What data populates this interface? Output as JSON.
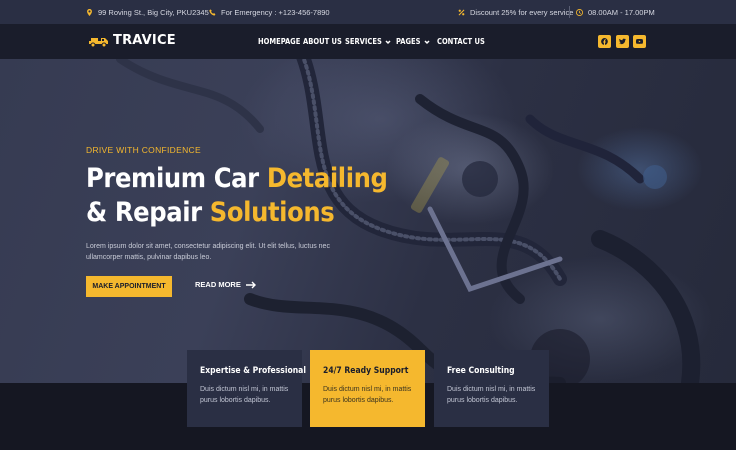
{
  "topbar": {
    "address": "99 Roving St., Big City, PKU2345",
    "emergency": "For Emergency : +123-456-7890",
    "discount": "Discount 25% for every service",
    "hours": "08.00AM - 17.00PM"
  },
  "brand": {
    "name": "TRAVICE"
  },
  "nav": {
    "items": [
      {
        "label": "HOMEPAGE"
      },
      {
        "label": "ABOUT US"
      },
      {
        "label": "SERVICES"
      },
      {
        "label": "PAGES"
      },
      {
        "label": "CONTACT US"
      }
    ]
  },
  "social": [
    "facebook-icon",
    "twitter-icon",
    "youtube-icon"
  ],
  "hero": {
    "eyebrow": "DRIVE WITH CONFIDENCE",
    "headline_line1_a": "Premium Car ",
    "headline_line1_b": "Detailing",
    "headline_line2_a": "& Repair ",
    "headline_line2_b": "Solutions",
    "lede": "Lorem ipsum dolor sit amet, consectetur adipiscing elit. Ut elit tellus, luctus nec ullamcorper mattis, pulvinar dapibus leo.",
    "cta_primary": "MAKE APPOINTMENT",
    "cta_secondary": "READ MORE"
  },
  "features": [
    {
      "title": "Expertise & Professional",
      "text": "Duis dictum nisl mi, in mattis purus lobortis dapibus."
    },
    {
      "title": "24/7 Ready Support",
      "text": "Duis dictum nisl mi, in mattis purus lobortis dapibus."
    },
    {
      "title": "Free Consulting",
      "text": "Duis dictum nisl mi, in mattis purus lobortis dapibus."
    }
  ],
  "colors": {
    "accent": "#f5b82e",
    "dark": "#1a1d2b",
    "card": "#2a2f44"
  }
}
